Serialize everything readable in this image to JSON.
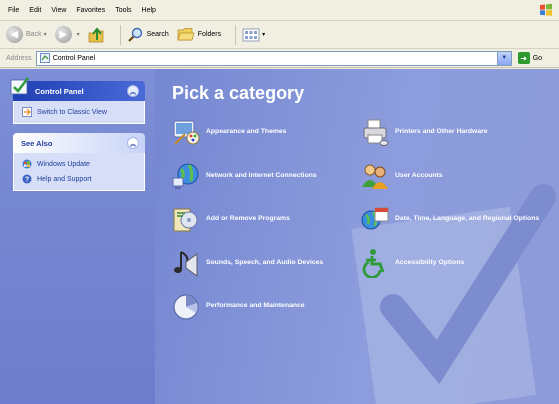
{
  "menubar": {
    "items": [
      "File",
      "Edit",
      "View",
      "Favorites",
      "Tools",
      "Help"
    ]
  },
  "toolbar": {
    "back_label": "Back",
    "search_label": "Search",
    "folders_label": "Folders"
  },
  "address": {
    "label": "Address",
    "value": "Control Panel",
    "go_label": "Go"
  },
  "sidebar": {
    "control_panel": {
      "title": "Control Panel",
      "links": [
        "Switch to Classic View"
      ]
    },
    "see_also": {
      "title": "See Also",
      "links": [
        "Windows Update",
        "Help and Support"
      ]
    }
  },
  "main": {
    "title": "Pick a category",
    "categories": [
      {
        "label": "Appearance and Themes",
        "icon": "appearance-icon"
      },
      {
        "label": "Printers and Other Hardware",
        "icon": "printer-icon"
      },
      {
        "label": "Network and Internet Connections",
        "icon": "network-icon"
      },
      {
        "label": "User Accounts",
        "icon": "user-accounts-icon"
      },
      {
        "label": "Add or Remove Programs",
        "icon": "add-remove-programs-icon"
      },
      {
        "label": "Date, Time, Language, and Regional Options",
        "icon": "date-time-icon"
      },
      {
        "label": "Sounds, Speech, and Audio Devices",
        "icon": "sounds-icon"
      },
      {
        "label": "Accessibility Options",
        "icon": "accessibility-icon"
      },
      {
        "label": "Performance and Maintenance",
        "icon": "performance-icon"
      }
    ]
  },
  "colors": {
    "main_bg": "#8594d8",
    "sidebar_bg": "#7587d2",
    "panel_header": "#2a4bc0",
    "link": "#223c9c"
  }
}
